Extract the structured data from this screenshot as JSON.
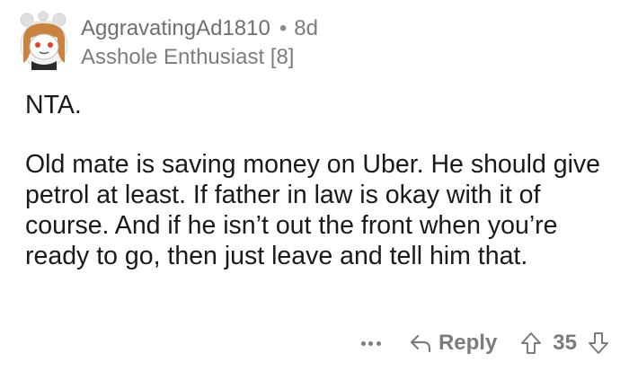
{
  "comment": {
    "username": "AggravatingAd1810",
    "separator": "•",
    "age": "8d",
    "flair": "Asshole Enthusiast [8]",
    "paragraphs": [
      "NTA.",
      "Old mate is saving money on Uber. He should give petrol at least. If father in law is okay with it of course. And if he isn’t out the front when you’re ready to go, then just leave and tell him that."
    ]
  },
  "actions": {
    "more_icon": "more-horizontal-icon",
    "reply_icon": "reply-arrow-icon",
    "reply_label": "Reply",
    "upvote_icon": "upvote-arrow-icon",
    "score": "35",
    "downvote_icon": "downvote-arrow-icon"
  },
  "colors": {
    "text": "#1a1a1b",
    "meta": "#7c7c7c",
    "background": "#ffffff"
  }
}
